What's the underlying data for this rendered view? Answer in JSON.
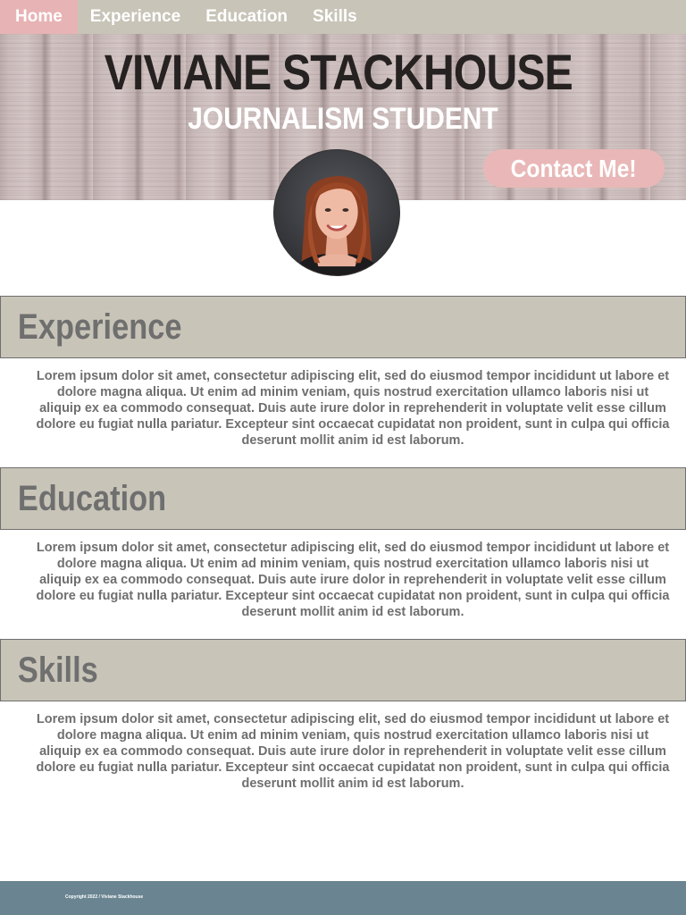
{
  "nav": {
    "items": [
      {
        "label": "Home",
        "active": true
      },
      {
        "label": "Experience",
        "active": false
      },
      {
        "label": "Education",
        "active": false
      },
      {
        "label": "Skills",
        "active": false
      }
    ]
  },
  "hero": {
    "name": "VIVIANE STACKHOUSE",
    "subtitle": "JOURNALISM STUDENT",
    "contact_label": "Contact Me!"
  },
  "sections": [
    {
      "title": "Experience",
      "body": "Lorem ipsum dolor sit amet, consectetur adipiscing elit, sed do eiusmod tempor incididunt ut labore et dolore magna aliqua. Ut enim ad minim veniam, quis nostrud exercitation ullamco laboris nisi ut aliquip ex ea commodo consequat. Duis aute irure dolor in reprehenderit in voluptate velit esse cillum dolore eu fugiat nulla pariatur. Excepteur sint occaecat cupidatat non proident, sunt in culpa qui officia deserunt mollit anim id est laborum."
    },
    {
      "title": "Education",
      "body": "Lorem ipsum dolor sit amet, consectetur adipiscing elit, sed do eiusmod tempor incididunt ut labore et dolore magna aliqua. Ut enim ad minim veniam, quis nostrud exercitation ullamco laboris nisi ut aliquip ex ea commodo consequat. Duis aute irure dolor in reprehenderit in voluptate velit esse cillum dolore eu fugiat nulla pariatur. Excepteur sint occaecat cupidatat non proident, sunt in culpa qui officia deserunt mollit anim id est laborum."
    },
    {
      "title": "Skills",
      "body": "Lorem ipsum dolor sit amet, consectetur adipiscing elit, sed do eiusmod tempor incididunt ut labore et dolore magna aliqua. Ut enim ad minim veniam, quis nostrud exercitation ullamco laboris nisi ut aliquip ex ea commodo consequat. Duis aute irure dolor in reprehenderit in voluptate velit esse cillum dolore eu fugiat nulla pariatur. Excepteur sint occaecat cupidatat non proident, sunt in culpa qui officia deserunt mollit anim id est laborum."
    }
  ],
  "footer": {
    "copyright": "Copyright 2022 / Viviane Stackhouse"
  },
  "colors": {
    "nav_bg": "#c8c4b8",
    "accent_pink": "#e7b3b4",
    "section_bar": "#c8c4b8",
    "text_gray": "#6f6f6f",
    "footer_bg": "#6a8591"
  },
  "icons": {
    "avatar": "profile-photo"
  }
}
